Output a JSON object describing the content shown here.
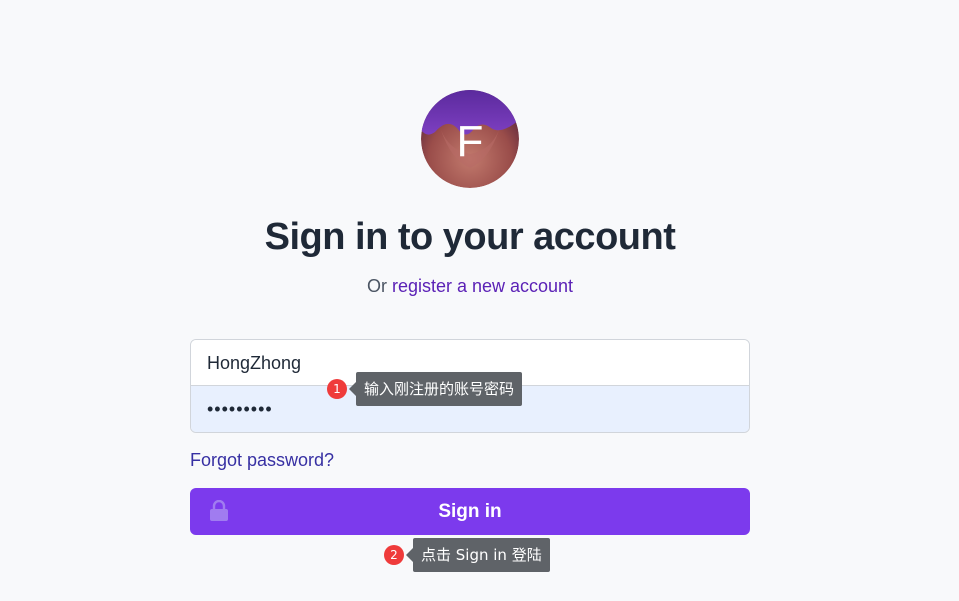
{
  "page": {
    "title": "Sign in to your account",
    "subtitle_prefix": "Or",
    "register_link": "register a new account"
  },
  "logo": {
    "letter": "F"
  },
  "form": {
    "username_value": "HongZhong",
    "password_value": "•••••••••",
    "forgot_link": "Forgot password?",
    "signin_label": "Sign in"
  },
  "annotations": [
    {
      "number": "1",
      "text": "输入刚注册的账号密码"
    },
    {
      "number": "2",
      "text": "点击 Sign in 登陆"
    }
  ],
  "colors": {
    "accent": "#7c3aed",
    "link": "#5b21b6",
    "marker": "#ef3b3b"
  },
  "icons": {
    "button_icon": "lock-icon"
  }
}
